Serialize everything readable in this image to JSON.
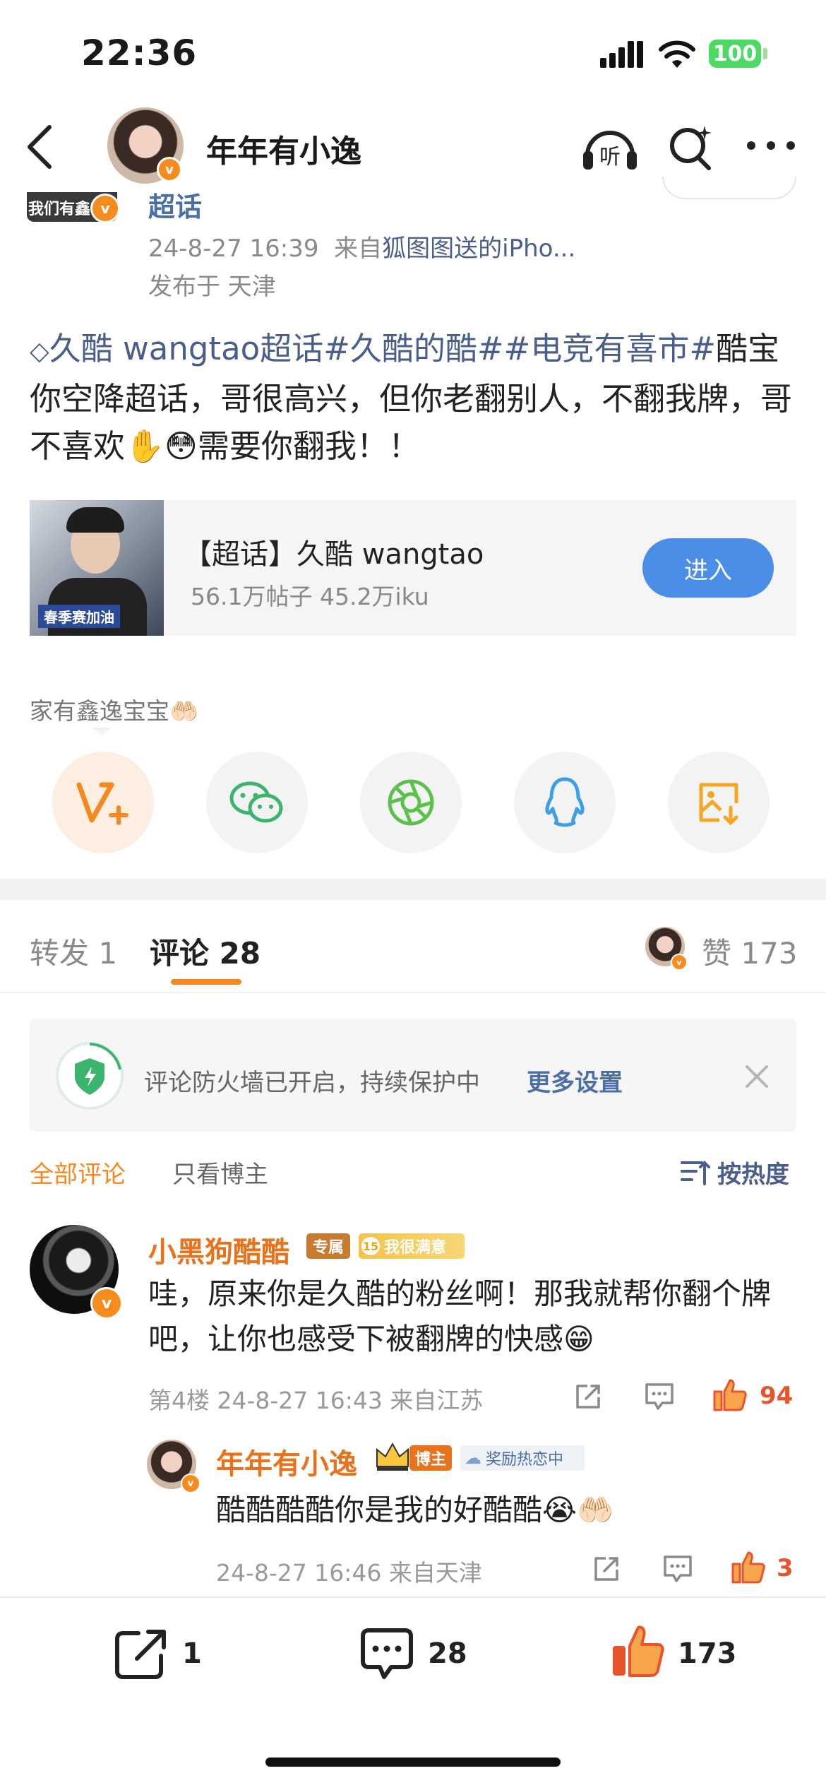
{
  "status_bar": {
    "time": "22:36",
    "battery": "100"
  },
  "header": {
    "username": "年年有小逸",
    "listen_label": "听"
  },
  "post": {
    "prev_avatar_caption": "我们有鑫",
    "topic_title": "超话",
    "timestamp": "24-8-27 16:39",
    "source_prefix": "来自",
    "source": "狐图图送的iPho...",
    "location": "发布于 天津",
    "text_topic": "久酷 wangtao超话#久酷的酷##电竞有喜市#",
    "text_body": "酷宝你空降超话，哥很高兴，但你老翻别人，不翻我牌，哥不喜欢",
    "text_emoji": "✋😳",
    "text_tail": "需要你翻我！！",
    "card": {
      "image_caption": "春季赛加油",
      "title": "【超话】久酷 wangtao",
      "stats": "56.1万帖子 45.2万iku",
      "button": "进入"
    },
    "tagline": "家有鑫逸宝宝🤲🏻"
  },
  "share_icons": [
    "weibo-v-plus-icon",
    "wechat-icon",
    "moments-icon",
    "qq-icon",
    "save-image-icon"
  ],
  "tabs": {
    "repost": "转发 1",
    "comments": "评论 28",
    "likes": "赞 173"
  },
  "firewall": {
    "text": "评论防火墙已开启，持续保护中",
    "more": "更多设置"
  },
  "filters": {
    "all": "全部评论",
    "op_only": "只看博主",
    "sort": "按热度"
  },
  "comments": [
    {
      "name": "小黑狗酷酷",
      "badge1": "专属",
      "badge2_num": "15",
      "badge2": "我很满意",
      "text": "哇，原来你是久酷的粉丝啊！那我就帮你翻个牌吧，让你也感受下被翻牌的快感😁",
      "meta": "第4楼 24-8-27 16:43 来自江苏",
      "likes": "94"
    }
  ],
  "reply": {
    "name": "年年有小逸",
    "badge1": "博主",
    "badge2": "奖励热恋中",
    "text": "酷酷酷酷你是我的好酷酷😭🤲🏻",
    "meta": "24-8-27 16:46 来自天津",
    "likes": "3"
  },
  "bottom_bar": {
    "reposts": "1",
    "comments": "28",
    "likes": "173"
  },
  "colors": {
    "accent": "#f5891f",
    "link": "#4a5e8c",
    "button_blue": "#4a8ee8",
    "like_red": "#e8542c"
  }
}
